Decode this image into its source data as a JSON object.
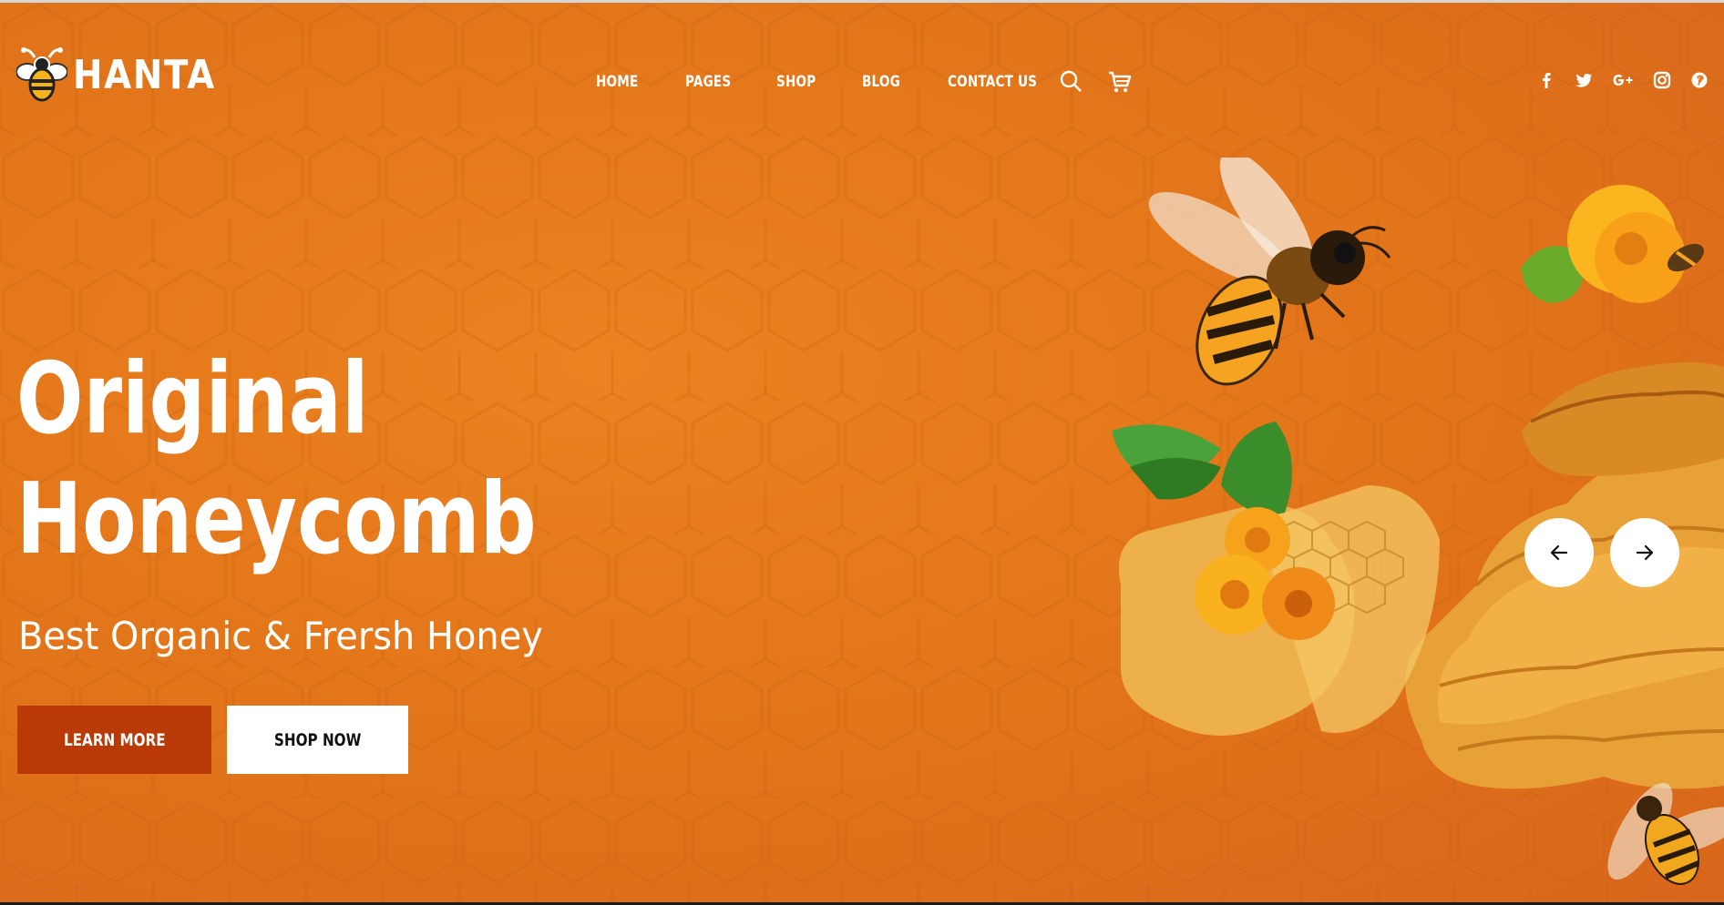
{
  "brand": {
    "name": "HANTA",
    "logo_icon": "bee-icon"
  },
  "nav": {
    "items": [
      "Home",
      "Pages",
      "Shop",
      "Blog",
      "Contact Us"
    ],
    "search_icon": "search-icon",
    "cart_icon": "cart-icon"
  },
  "social": [
    "facebook-icon",
    "twitter-icon",
    "google-plus-icon",
    "instagram-icon",
    "pinterest-icon"
  ],
  "hero": {
    "title_line1": "Original",
    "title_line2": "Honeycomb",
    "subtitle": "Best Organic & Frersh Honey",
    "learn_more": "Learn More",
    "shop_now": "Shop Now",
    "prev_icon": "arrow-left-icon",
    "next_icon": "arrow-right-icon"
  },
  "colors": {
    "background": "#e6781a",
    "learn_more_button": "#b93a06",
    "shop_now_button": "#ffffff",
    "text": "#ffffff"
  }
}
